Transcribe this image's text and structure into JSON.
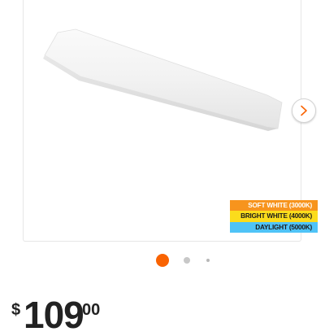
{
  "colors": {
    "accent": "#f96302",
    "soft_white": "#f7941d",
    "bright_white": "#fbdc1c",
    "daylight": "#4fc3f7",
    "dot_inactive_1": "#c8c8c8",
    "dot_inactive_2": "#b8b8b8"
  },
  "gallery": {
    "next_icon": "chevron-right-icon",
    "legend": [
      {
        "label": "SOFT WHITE (3000K)"
      },
      {
        "label": "BRIGHT WHITE (4000K)"
      },
      {
        "label": "DAYLIGHT (5000K)"
      }
    ],
    "dots": [
      {
        "active": true
      },
      {
        "active": false
      },
      {
        "active": false
      }
    ]
  },
  "price": {
    "currency": "$",
    "dollars": "109",
    "cents": "00"
  }
}
